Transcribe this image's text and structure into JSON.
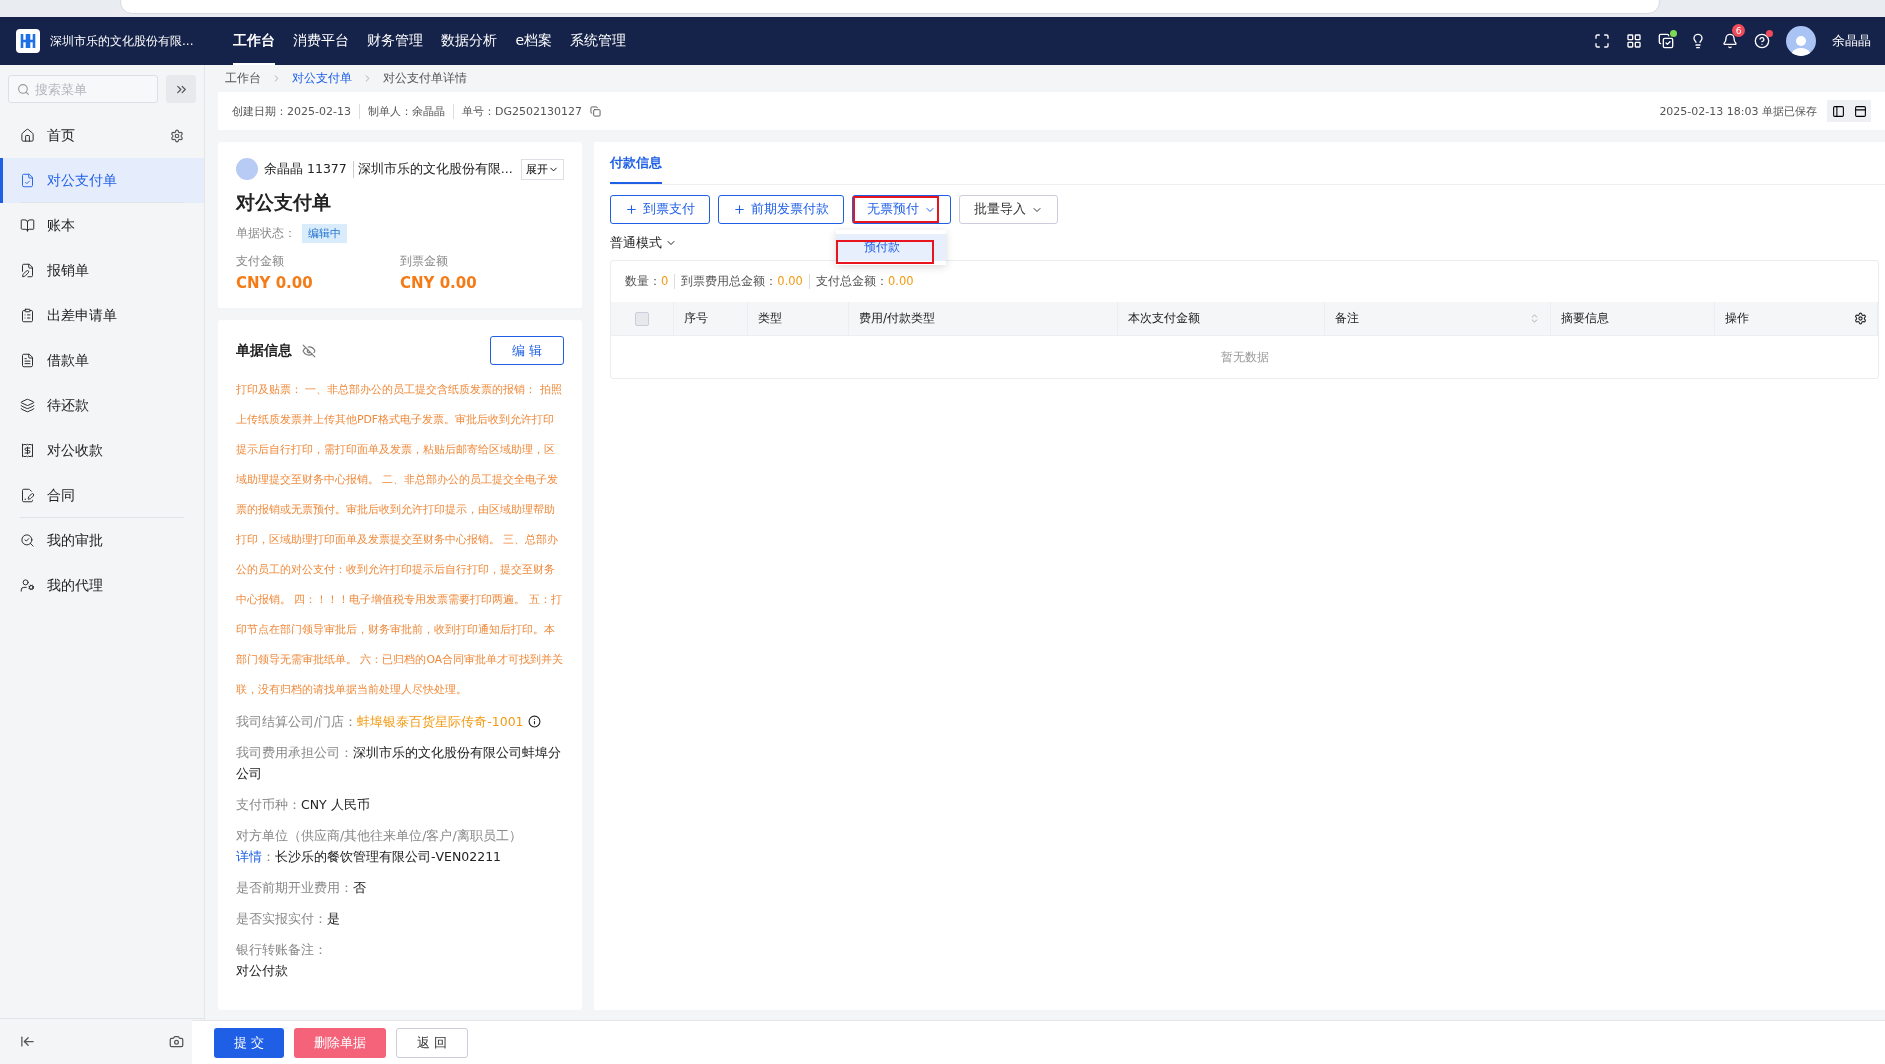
{
  "header": {
    "company": "深圳市乐的文化股份有限...",
    "nav": [
      {
        "label": "工作台",
        "selected": true
      },
      {
        "label": "消费平台",
        "selected": false
      },
      {
        "label": "财务管理",
        "selected": false
      },
      {
        "label": "数据分析",
        "selected": false
      },
      {
        "label": "e档案",
        "selected": false
      },
      {
        "label": "系统管理",
        "selected": false
      }
    ],
    "notification_count": "6",
    "user": "余晶晶"
  },
  "sidebar": {
    "search_placeholder": "搜索菜单",
    "items": [
      {
        "label": "首页",
        "selected": false,
        "settings": true,
        "divider_after": false
      },
      {
        "label": "对公支付单",
        "selected": true,
        "settings": false,
        "divider_after": true
      },
      {
        "label": "账本",
        "selected": false,
        "settings": false,
        "divider_after": false
      },
      {
        "label": "报销单",
        "selected": false,
        "settings": false,
        "divider_after": false
      },
      {
        "label": "出差申请单",
        "selected": false,
        "settings": false,
        "divider_after": false
      },
      {
        "label": "借款单",
        "selected": false,
        "settings": false,
        "divider_after": false
      },
      {
        "label": "待还款",
        "selected": false,
        "settings": false,
        "divider_after": false
      },
      {
        "label": "对公收款",
        "selected": false,
        "settings": false,
        "divider_after": false
      },
      {
        "label": "合同",
        "selected": false,
        "settings": false,
        "divider_after": true
      },
      {
        "label": "我的审批",
        "selected": false,
        "settings": false,
        "divider_after": false
      },
      {
        "label": "我的代理",
        "selected": false,
        "settings": false,
        "divider_after": false
      }
    ]
  },
  "breadcrumb": [
    {
      "label": "工作台",
      "link": false
    },
    {
      "label": "对公支付单",
      "link": true
    },
    {
      "label": "对公支付单详情",
      "link": false
    }
  ],
  "meta": {
    "fields": [
      {
        "label": "创建日期：",
        "value": "2025-02-13"
      },
      {
        "label": "制单人：",
        "value": "余晶晶"
      },
      {
        "label": "单号：",
        "value": "DG2502130127"
      }
    ],
    "saved": "2025-02-13 18:03 单据已保存"
  },
  "summary": {
    "applicant": "余晶晶 11377",
    "company": "深圳市乐的文化股份有限...",
    "expand": "展开",
    "title": "对公支付单",
    "status_label": "单据状态：",
    "status": "编辑中",
    "amounts": [
      {
        "label": "支付金额",
        "value": "CNY 0.00"
      },
      {
        "label": "到票金额",
        "value": "CNY 0.00"
      }
    ]
  },
  "info": {
    "title": "单据信息",
    "edit": "编 辑",
    "notice": "打印及贴票： 一、非总部办公的员工提交含纸质发票的报销： 拍照上传纸质发票并上传其他PDF格式电子发票。审批后收到允许打印提示后自行打印，需打印面单及发票，粘贴后邮寄给区域助理，区域助理提交至财务中心报销。 二、非总部办公的员工提交全电子发票的报销或无票预付。审批后收到允许打印提示，由区域助理帮助打印，区域助理打印面单及发票提交至财务中心报销。 三、总部办公的员工的对公支付：收到允许打印提示后自行打印，提交至财务中心报销。 四：！！！电子增值税专用发票需要打印两遍。 五：打印节点在部门领导审批后，财务审批前，收到打印通知后打印。本部门领导无需审批纸单。 六：已归档的OA合同审批单才可找到并关联，没有归档的请找单据当前处理人尽快处理。",
    "fields": [
      {
        "kind": "highlight",
        "label": "我司结算公司/门店：",
        "value": "蚌埠银泰百货星际传奇-1001"
      },
      {
        "kind": "plain",
        "label": "我司费用承担公司：",
        "value": "深圳市乐的文化股份有限公司蚌埠分公司"
      },
      {
        "kind": "plain",
        "label": "支付币种：",
        "value": "CNY 人民币"
      },
      {
        "kind": "link",
        "label": "对方单位（供应商/其他往来单位/客户/离职员工）",
        "link": "详情",
        "suffix": "：",
        "value": "长沙乐的餐饮管理有限公司-VEN02211"
      },
      {
        "kind": "plain",
        "label": "是否前期开业费用：",
        "value": "否"
      },
      {
        "kind": "plain",
        "label": "是否实报实付：",
        "value": "是"
      },
      {
        "kind": "block",
        "label": "银行转账备注：",
        "value": "对公付款"
      }
    ]
  },
  "actions": [
    {
      "label": "提 交",
      "kind": "primary"
    },
    {
      "label": "删除单据",
      "kind": "danger"
    },
    {
      "label": "返 回",
      "kind": "default"
    }
  ],
  "payment": {
    "tabs": [
      {
        "label": "付款信息",
        "selected": true
      }
    ],
    "toolbar": [
      {
        "label": "到票支付",
        "kind": "add",
        "highlighted": false
      },
      {
        "label": "前期发票付款",
        "kind": "add",
        "highlighted": false
      },
      {
        "label": "无票预付",
        "kind": "dropdown",
        "highlighted": true
      },
      {
        "label": "批量导入",
        "kind": "dropdown",
        "highlighted": false
      }
    ],
    "dropdown_items": [
      {
        "label": "预付款",
        "highlighted": true
      }
    ],
    "mode": "普通模式",
    "totals": [
      {
        "label": "数量：",
        "value": "0"
      },
      {
        "label": "到票费用总金额：",
        "value": "0.00"
      },
      {
        "label": "支付总金额：",
        "value": "0.00"
      }
    ],
    "table": {
      "select_all_checked": false,
      "columns": [
        {
          "label": "序号",
          "sortable": false
        },
        {
          "label": "类型",
          "sortable": false
        },
        {
          "label": "费用/付款类型",
          "sortable": false
        },
        {
          "label": "本次支付金额",
          "sortable": false
        },
        {
          "label": "备注",
          "sortable": true
        },
        {
          "label": "摘要信息",
          "sortable": false
        },
        {
          "label": "操作",
          "sortable": false
        }
      ],
      "empty": "暂无数据"
    }
  }
}
